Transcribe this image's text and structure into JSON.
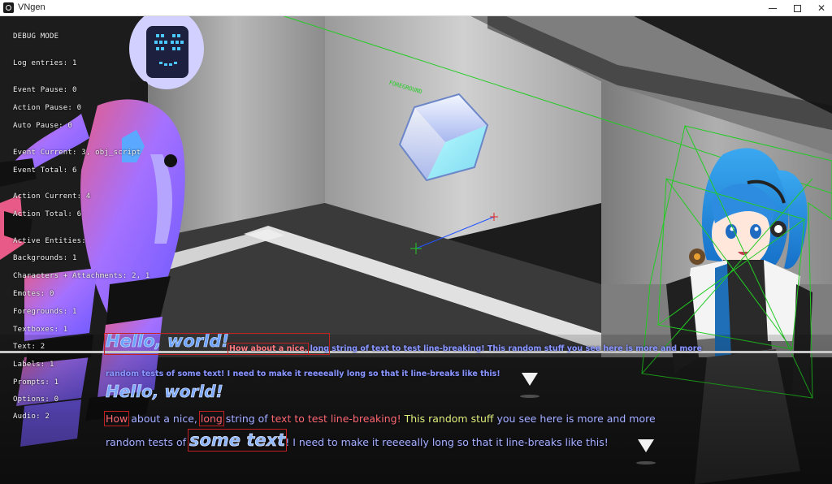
{
  "window": {
    "title": "VNgen",
    "controls": {
      "minimize": "—",
      "maximize": "□",
      "close": "✕"
    }
  },
  "debug": {
    "lines": [
      "DEBUG MODE",
      "Log entries: 1",
      "Event Pause: 0",
      "Action Pause: 0",
      "Auto Pause: 0",
      "Event Current: 3, obj_script",
      "Event Total: 6",
      "Action Current: 4",
      "Action Total: 6",
      "Active Entities:",
      "Backgrounds: 1",
      "Characters + Attachments: 2, 1",
      "Emotes: 0",
      "Foregrounds: 1",
      "Textboxes: 1",
      "Text: 2",
      "Labels: 1",
      "Prompts: 1",
      "Options: 0",
      "Audio: 2"
    ]
  },
  "scene": {
    "foreground_label": "FOREGROUND",
    "colors": {
      "debug_outline": "#22cc22",
      "text_outline": "#c02020",
      "path_line": "#2255ff",
      "name_text": "#6fa2ff"
    }
  },
  "textbox_a": {
    "name": "Hello, world!",
    "line1_prefix": "How about a nice,",
    "line1_rest": "long string of text to test line-breaking! This random stuff you see here is more and more",
    "line2": "random tests of some text! I need to make it reeeeally long so that it line-breaks like this!"
  },
  "textbox_b": {
    "name": "Hello, world!",
    "line1": {
      "w1": "How",
      "w2": " about a nice, ",
      "w3": "long",
      "w4": " string of ",
      "w5": "text to test line-breaking!",
      "w6": " This random stuff ",
      "w7": "you see here is more and more"
    },
    "line2": {
      "w1": "random tests of ",
      "w2": "some text",
      "w3": "! I need to make it reeeeally long so that it line-breaks like this!"
    }
  }
}
